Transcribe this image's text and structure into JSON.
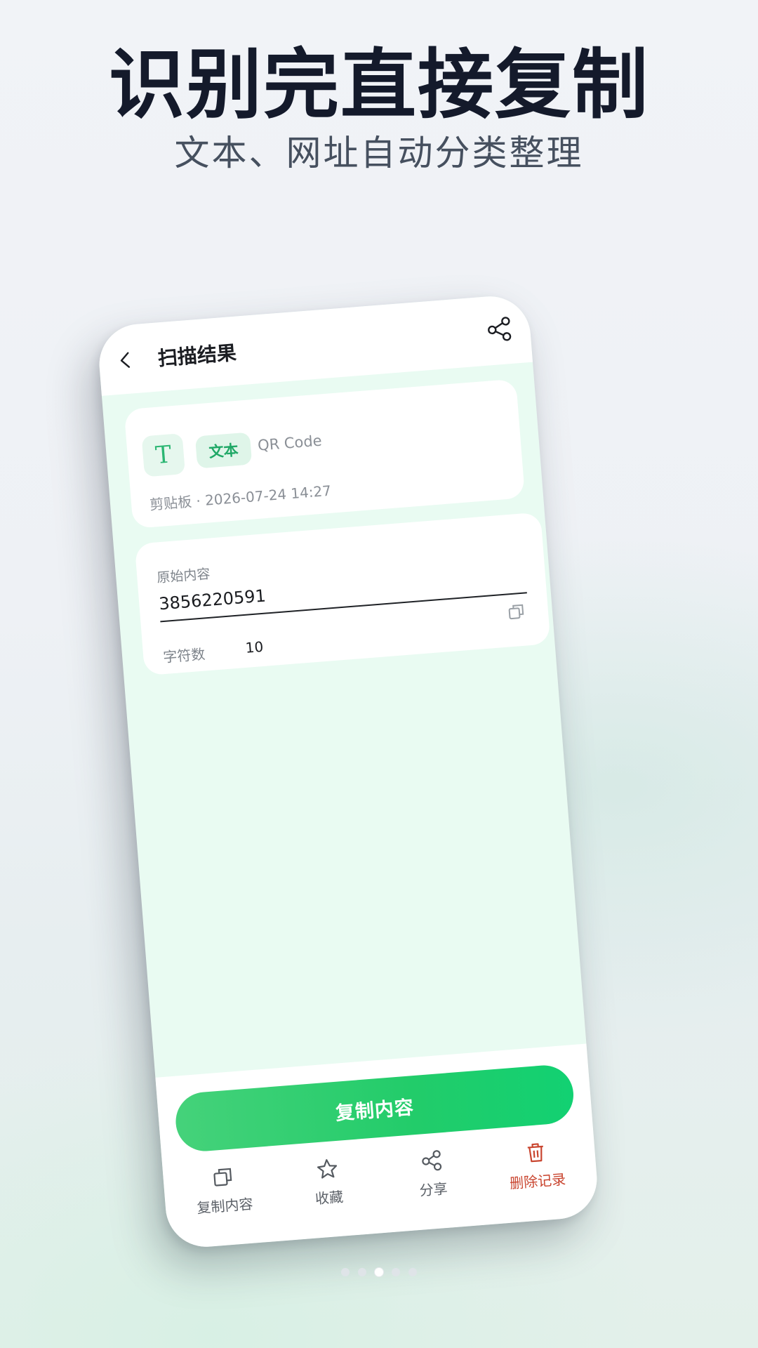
{
  "headline": "识别完直接复制",
  "subline": "文本、网址自动分类整理",
  "app": {
    "title": "扫描结果",
    "back_icon": "chevron-left-icon",
    "share_icon": "share-icon"
  },
  "info_card": {
    "type_glyph": "T",
    "type_label": "文本",
    "format": "QR Code",
    "source_time": "剪贴板 · 2026-07-24 14:27"
  },
  "content_card": {
    "field_label": "原始内容",
    "raw_value": "3856220591",
    "count_label": "字符数",
    "count_value": "10"
  },
  "primary_button": "复制内容",
  "actions": [
    {
      "label": "复制内容",
      "icon": "copy-icon"
    },
    {
      "label": "收藏",
      "icon": "star-icon"
    },
    {
      "label": "分享",
      "icon": "share-icon"
    },
    {
      "label": "删除记录",
      "icon": "trash-icon",
      "color": "#c9452f"
    }
  ],
  "colors": {
    "accent": "#22cc6a",
    "danger": "#c9452f",
    "screen_bg": "#e9fbf2"
  },
  "pager": {
    "count": 5,
    "active_index": 2
  }
}
